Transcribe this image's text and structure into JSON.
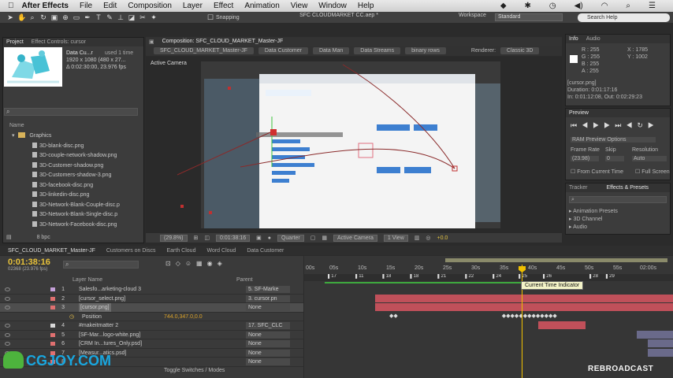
{
  "menubar": {
    "app_name": "After Effects",
    "items": [
      "File",
      "Edit",
      "Composition",
      "Layer",
      "Effect",
      "Animation",
      "View",
      "Window",
      "Help"
    ]
  },
  "toolbar": {
    "doc_title": "SFC CLOUDMARKET CC.aep *",
    "snapping_label": "Snapping",
    "workspace_label": "Workspace",
    "workspace_value": "Standard",
    "search_placeholder": "Search Help"
  },
  "project": {
    "tabs": [
      "Project",
      "Effect Controls: cursor"
    ],
    "asset_name": "Data Cu...r",
    "asset_used": "used 1 time",
    "asset_size": "1920 x 1080 (480 x 27...",
    "asset_duration": "Δ 0:02:30:00, 23.976 fps",
    "search_placeholder": "",
    "column_name": "Name",
    "folder": "Graphics",
    "items": [
      "3D-blank-disc.png",
      "3D-couple-network-shadow.png",
      "3D-Customer-shadow.png",
      "3D-Customers-shadow-3.png",
      "3D-facebook-disc.png",
      "3D-linkedin-disc.png",
      "3D-Network-Blank-Couple-disc.p",
      "3D-Network-Blank-Single-disc.p",
      "3D-Network-Facebook-disc.png"
    ],
    "footer_bpc": "8 bpc"
  },
  "composition": {
    "panel_title": "Composition: SFC_CLOUD_MARKET_Master-JF",
    "breadcrumbs": [
      "SFC_CLOUD_MARKET_Master-JF",
      "Data Customer",
      "Data Man",
      "Data Streams",
      "binary rows"
    ],
    "renderer_label": "Renderer:",
    "renderer_value": "Classic 3D",
    "active_camera": "Active Camera",
    "viewer_bar": {
      "zoom": "(29.8%)",
      "timecode": "0:01:38:16",
      "resolution": "Quarter",
      "camera": "Active Camera",
      "views": "1 View",
      "exposure": "+0.0"
    }
  },
  "info": {
    "tabs": [
      "Info",
      "Audio"
    ],
    "r": "R : 255",
    "g": "G : 255",
    "b": "B : 255",
    "a": "A : 255",
    "x": "X : 1785",
    "y": "Y : 1002",
    "layer": "[cursor.png]",
    "duration": "Duration: 0:01:17:16",
    "inout": "In: 0:01:12:08, Out: 0:02:29:23"
  },
  "preview": {
    "tab": "Preview",
    "ram_options": "RAM Preview Options",
    "frame_rate_label": "Frame Rate",
    "skip_label": "Skip",
    "resolution_label": "Resolution",
    "frame_rate_value": "(23.98)",
    "skip_value": "0",
    "resolution_value": "Auto",
    "from_current": "From Current Time",
    "full_screen": "Full Screen"
  },
  "effects": {
    "tabs": [
      "Tracker",
      "Effects & Presets"
    ],
    "items": [
      "Animation Presets",
      "3D Channel",
      "Audio"
    ]
  },
  "timeline": {
    "tabs": [
      "SFC_CLOUD_MARKET_Master-JF",
      "Customers on Discs",
      "Earth Cloud",
      "Word Cloud",
      "Data Customer"
    ],
    "timecode": "0:01:38:16",
    "frames": "02368 (23.976 fps)",
    "col_layer_name": "Layer Name",
    "col_parent": "Parent",
    "ruler": [
      "00s",
      "05s",
      "10s",
      "15s",
      "20s",
      "25s",
      "30s",
      "35s",
      "40s",
      "45s",
      "50s",
      "55s",
      "02:00s"
    ],
    "tooltip": "Current Time Indicator",
    "footer": "Toggle Switches / Modes",
    "layers": [
      {
        "num": "1",
        "name": "Salesfo...arketing-cloud 3",
        "parent": "5. SF-Marke",
        "label_color": "#c4a0d8"
      },
      {
        "num": "2",
        "name": "[cursor_select.png]",
        "parent": "3. cursor.pn",
        "label_color": "#e07070"
      },
      {
        "num": "3",
        "name": "[cursor.png]",
        "parent": "None",
        "label_color": "#e07070"
      },
      {
        "num": "",
        "name": "Position",
        "parent": "",
        "label_color": "",
        "value": "744.0,347.0,0.0"
      },
      {
        "num": "4",
        "name": "#makeitmatter 2",
        "parent": "17. SFC_CLC",
        "label_color": "#d8d8d8"
      },
      {
        "num": "5",
        "name": "[SF-Mar...logo-white.png]",
        "parent": "None",
        "label_color": "#e07070"
      },
      {
        "num": "6",
        "name": "[CRM In...tures_Only.psd]",
        "parent": "None",
        "label_color": "#e07070"
      },
      {
        "num": "7",
        "name": "[Measur...atics.psd]",
        "parent": "None",
        "label_color": "#e07070"
      },
      {
        "num": "8",
        "name": "",
        "parent": "None",
        "label_color": "#e07070"
      }
    ]
  },
  "watermark_left": "CGJOY.COM",
  "watermark_right": "REBROADCAST"
}
